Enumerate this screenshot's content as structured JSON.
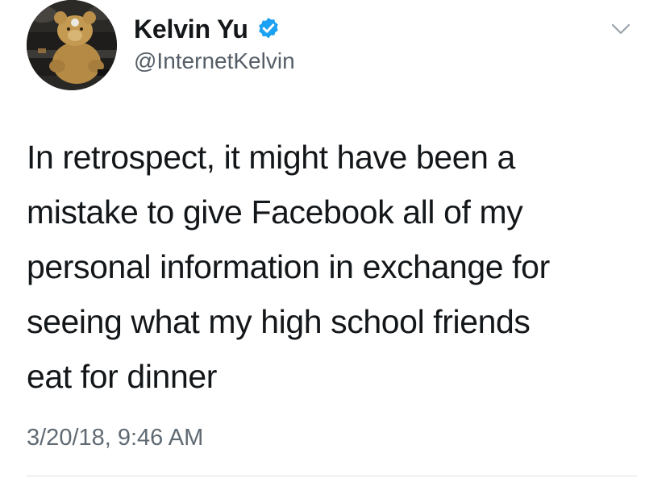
{
  "author": {
    "display_name": "Kelvin Yu",
    "handle": "@InternetKelvin",
    "verified_icon": "verified-badge-icon",
    "avatar_icon": "teddy-bear-avatar"
  },
  "tweet": {
    "text_lines": [
      "In retrospect, it might have been a",
      "mistake to give Facebook all of my",
      "personal information in exchange for",
      "seeing what my high school friends",
      "eat for dinner"
    ],
    "timestamp": "3/20/18, 9:46 AM"
  },
  "menu": {
    "icon": "chevron-down-icon"
  },
  "colors": {
    "text": "#14171a",
    "muted": "#606a73",
    "verified_blue": "#1da1f2",
    "divider": "#d9dee3"
  }
}
